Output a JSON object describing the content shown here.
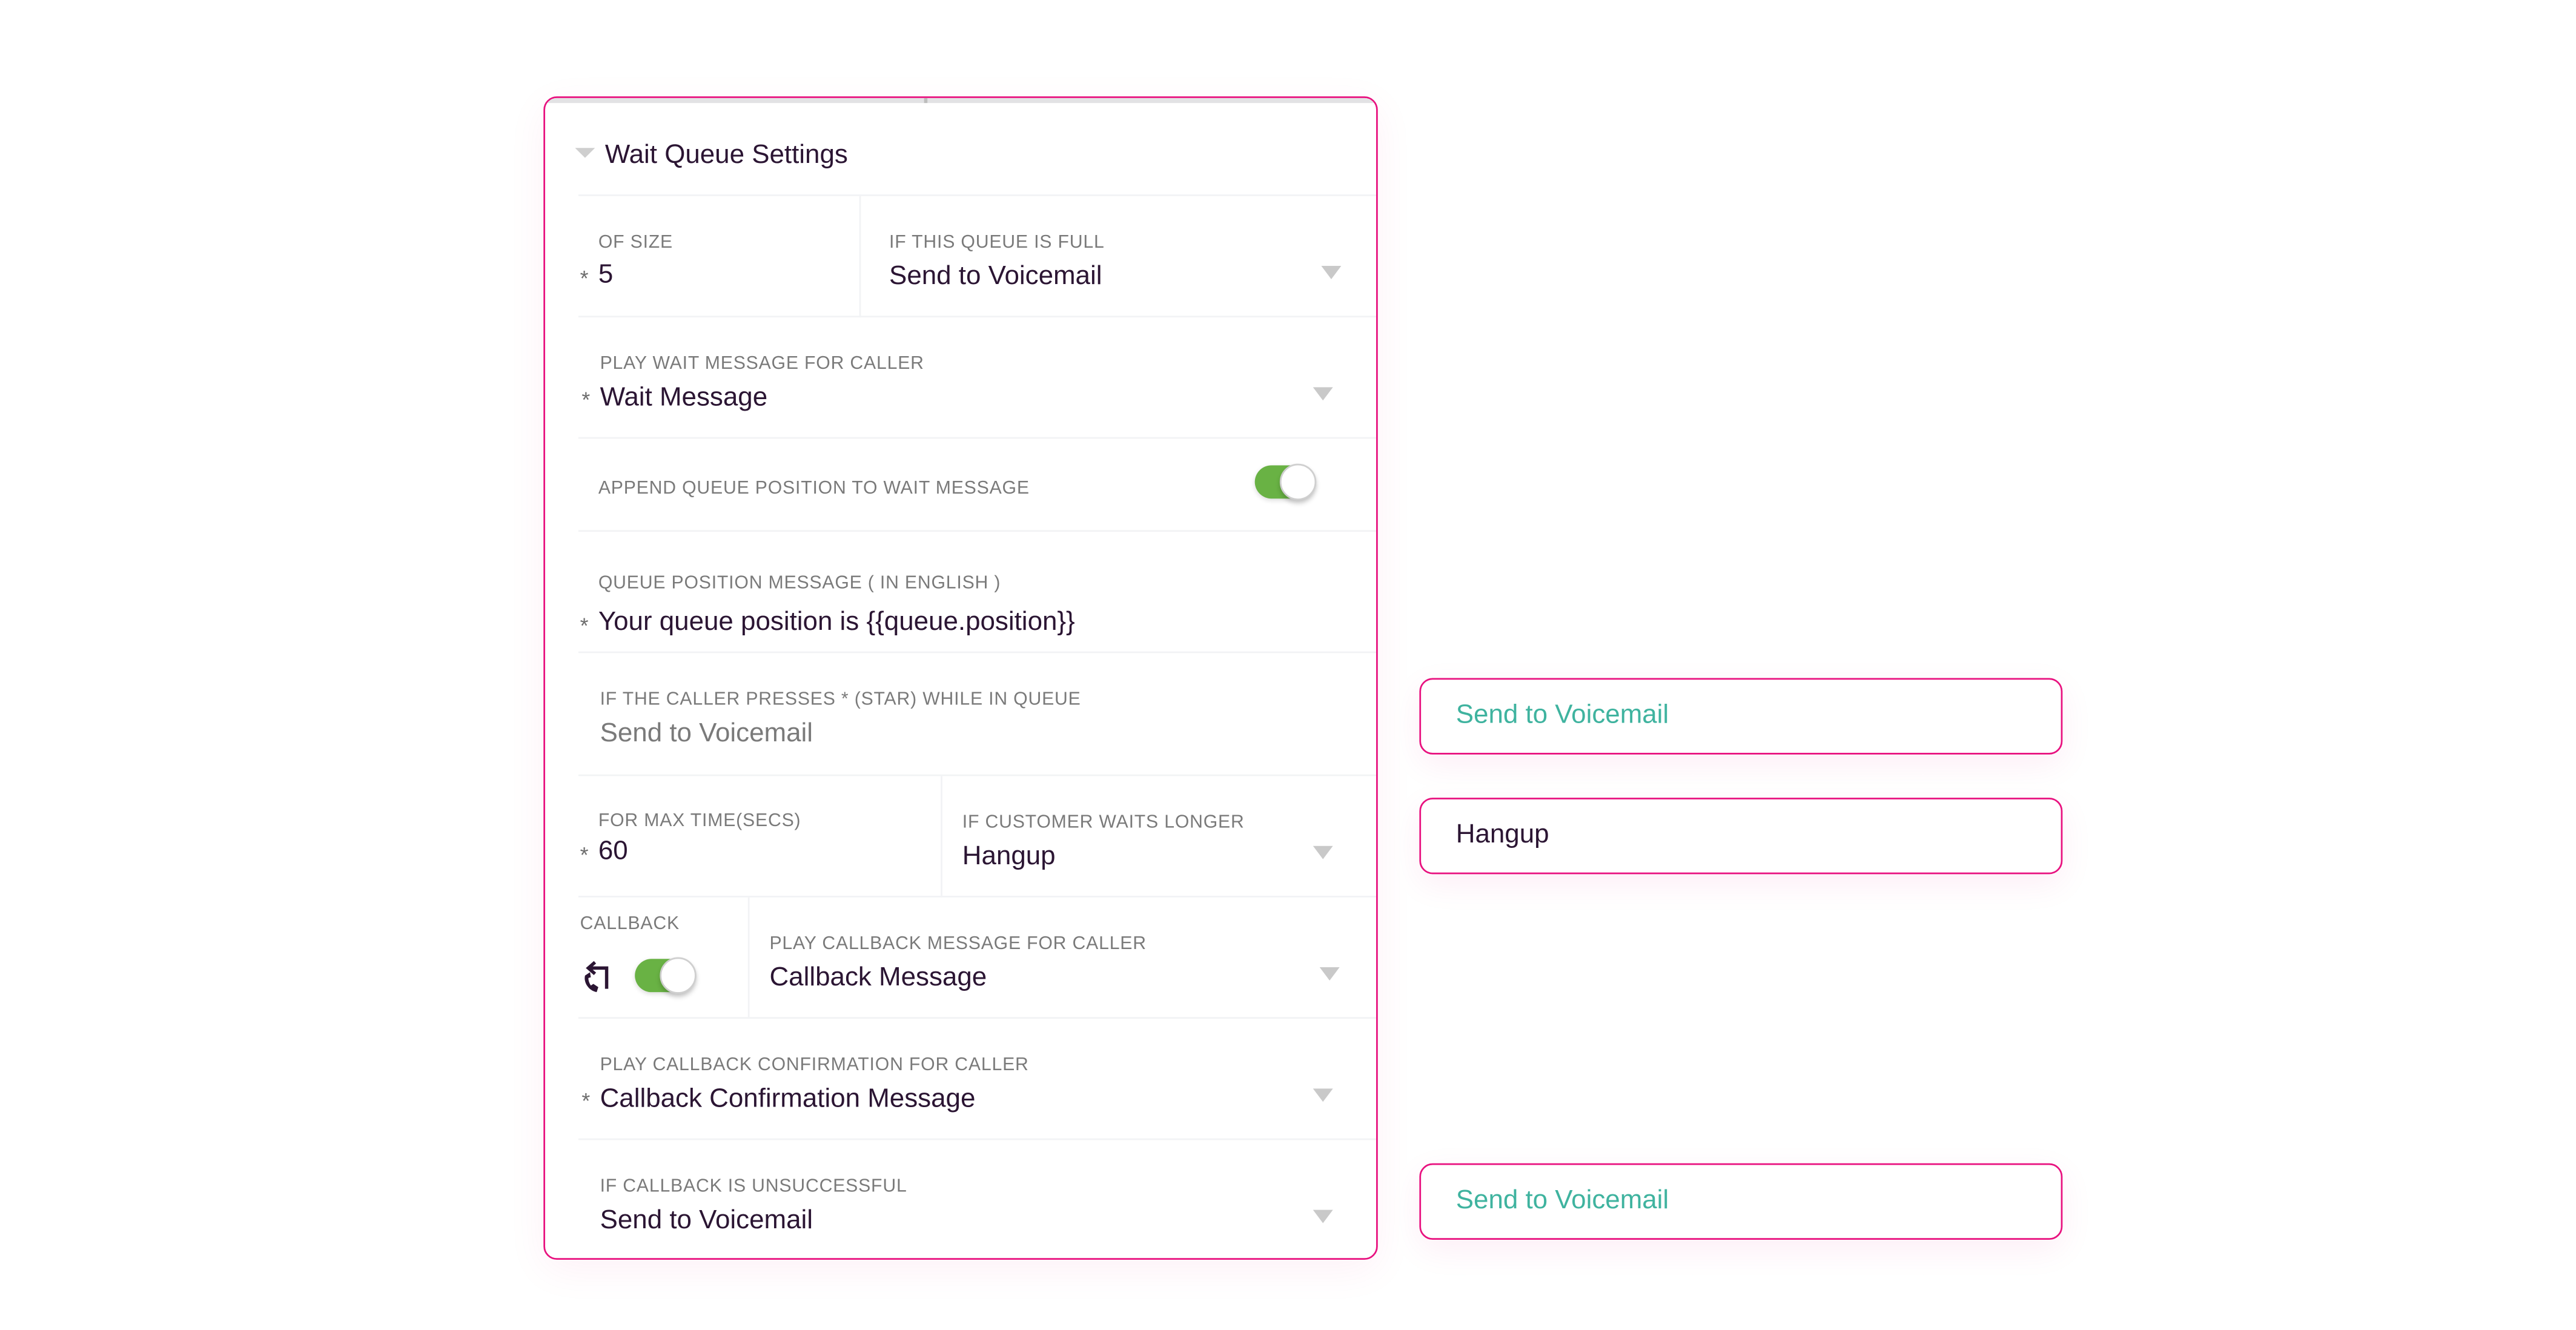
{
  "section": {
    "title": "Wait Queue Settings",
    "expanded": true
  },
  "fields": {
    "of_size": {
      "label": "OF SIZE",
      "required_marker": "*",
      "value": "5"
    },
    "if_queue_full": {
      "label": "IF THIS QUEUE IS FULL",
      "value": "Send to Voicemail"
    },
    "wait_message": {
      "label": "PLAY WAIT MESSAGE FOR CALLER",
      "required_marker": "*",
      "value": "Wait Message"
    },
    "append_position": {
      "label": "APPEND QUEUE POSITION TO WAIT MESSAGE",
      "enabled": true
    },
    "queue_position_message": {
      "label": "QUEUE POSITION MESSAGE ( IN ENGLISH )",
      "required_marker": "*",
      "value": "Your queue position is {{queue.position}}"
    },
    "star_press": {
      "label": "IF THE CALLER PRESSES * (STAR) WHILE IN QUEUE",
      "value": "Send to Voicemail"
    },
    "max_time": {
      "label": "FOR MAX TIME(SECS)",
      "required_marker": "*",
      "value": "60"
    },
    "waits_longer": {
      "label": "IF CUSTOMER WAITS LONGER",
      "value": "Hangup"
    },
    "callback": {
      "label": "CALLBACK",
      "enabled": true,
      "icon": "callback-phone-icon"
    },
    "callback_message": {
      "label": "PLAY CALLBACK MESSAGE FOR CALLER",
      "value": "Callback Message"
    },
    "callback_confirmation": {
      "label": "PLAY CALLBACK CONFIRMATION FOR CALLER",
      "required_marker": "*",
      "value": "Callback Confirmation Message"
    },
    "callback_unsuccessful": {
      "label": "IF CALLBACK IS UNSUCCESSFUL",
      "value": "Send to Voicemail"
    }
  },
  "side_outputs": [
    {
      "label": "Send to Voicemail",
      "color": "#3fb39f"
    },
    {
      "label": "Hangup",
      "color": "#2b1533"
    },
    {
      "label": "Send to Voicemail",
      "color": "#3fb39f"
    }
  ],
  "colors": {
    "border_accent": "#e8117f",
    "toggle_on": "#69b244",
    "teal_text": "#3fb39f",
    "primary_text": "#2b1533"
  }
}
